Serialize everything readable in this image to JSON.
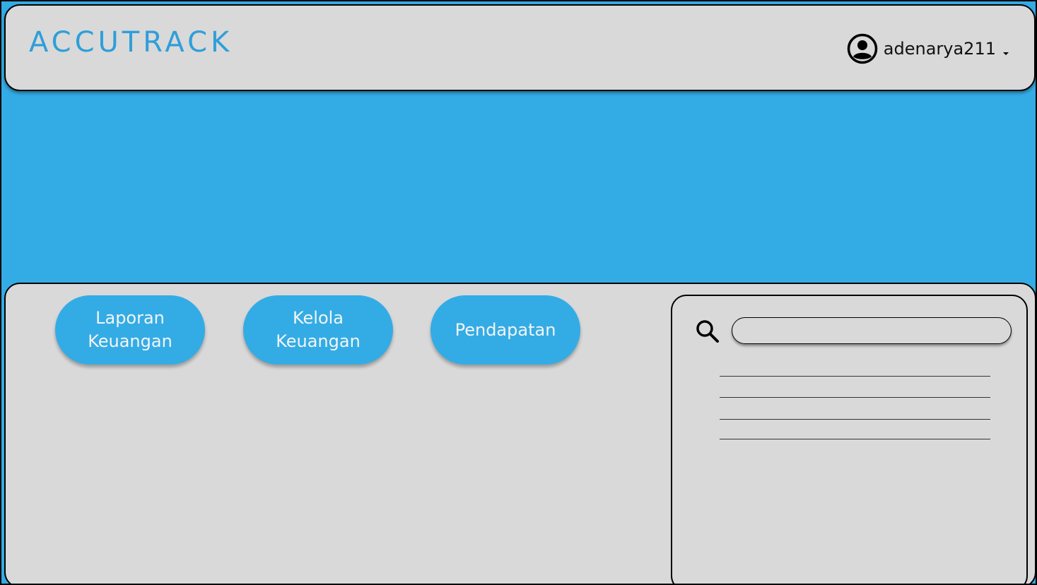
{
  "header": {
    "logo": "ACCUTRACK",
    "user": {
      "username": "adenarya211",
      "avatar_icon": "user-circle-icon",
      "menu_icon": "caret-down-icon"
    }
  },
  "menu": {
    "buttons": [
      {
        "label": "Laporan\nKeuangan"
      },
      {
        "label": "Kelola\nKeuangan"
      },
      {
        "label": "Pendapatan"
      }
    ]
  },
  "search": {
    "icon": "search-icon",
    "value": "",
    "placeholder": ""
  },
  "colors": {
    "accent": "#33ace6",
    "logo": "#2e9fd9",
    "panel": "#d9d9d9",
    "border": "#000000"
  }
}
